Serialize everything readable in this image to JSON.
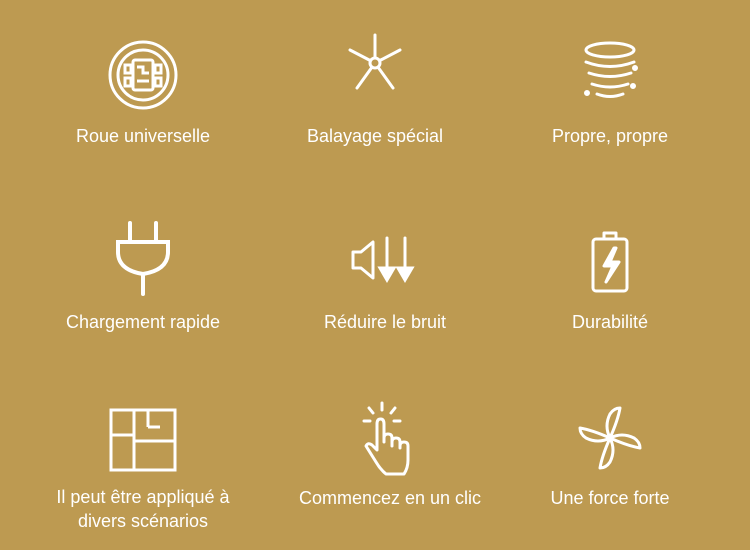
{
  "features": [
    {
      "label": "Roue universelle",
      "icon": "wheel-icon"
    },
    {
      "label": "Balayage spécial",
      "icon": "side-brush-icon"
    },
    {
      "label": "Propre, propre",
      "icon": "cyclone-icon"
    },
    {
      "label": "Chargement rapide",
      "icon": "plug-icon"
    },
    {
      "label": "Réduire le bruit",
      "icon": "noise-reduction-icon"
    },
    {
      "label": "Durabilité",
      "icon": "battery-icon"
    },
    {
      "label": "Il peut être appliqué à divers scénarios",
      "icon": "floor-plan-icon"
    },
    {
      "label": "Commencez en un clic",
      "icon": "one-click-icon"
    },
    {
      "label": "Une force forte",
      "icon": "fan-icon"
    }
  ],
  "colors": {
    "background": "#bd9a51",
    "foreground": "#ffffff"
  }
}
